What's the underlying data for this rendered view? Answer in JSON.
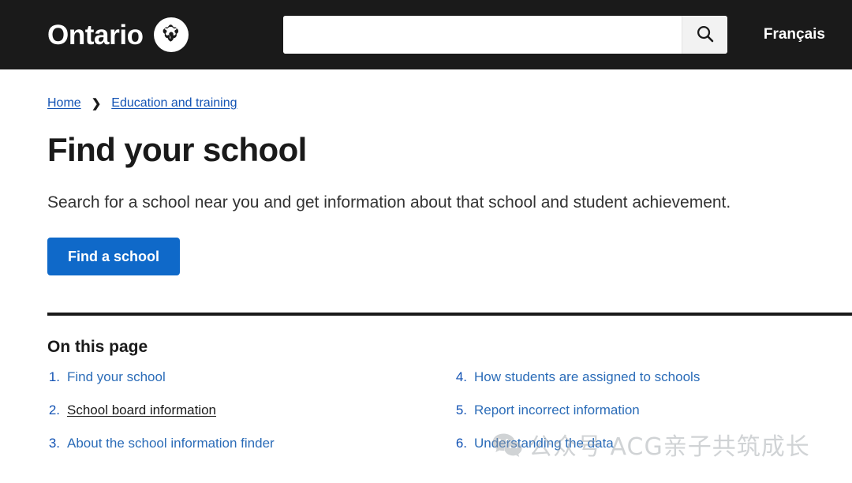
{
  "header": {
    "brand_name": "Ontario",
    "logo_icon": "ontario-trillium-icon",
    "language_toggle": "Français",
    "search": {
      "value": "",
      "placeholder": "",
      "button_icon": "search-icon",
      "button_label": "Search"
    }
  },
  "breadcrumb": {
    "items": [
      {
        "label": "Home"
      },
      {
        "label": "Education and training"
      }
    ],
    "separator": "❯"
  },
  "main": {
    "title": "Find your school",
    "lede": "Search for a school near you and get information about that school and student achievement.",
    "cta_label": "Find a school"
  },
  "on_this_page": {
    "heading": "On this page",
    "left_items": [
      {
        "number": "1.",
        "label": "Find your school",
        "hovered": false
      },
      {
        "number": "2.",
        "label": "School board information",
        "hovered": true
      },
      {
        "number": "3.",
        "label": "About the school information finder",
        "hovered": false
      }
    ],
    "right_items": [
      {
        "number": "4.",
        "label": "How students are assigned to schools",
        "hovered": false
      },
      {
        "number": "5.",
        "label": "Report incorrect information",
        "hovered": false
      },
      {
        "number": "6.",
        "label": "Understanding the data",
        "hovered": false
      }
    ]
  },
  "watermark": {
    "icon": "wechat-icon",
    "text": "公众号 ACG亲子共筑成长"
  },
  "colors": {
    "header_bg": "#1a1a1a",
    "link_blue": "#1353b4",
    "list_link_blue": "#2b6cb8",
    "cta_blue": "#0f69c9",
    "text_dark": "#1a1a1a",
    "watermark_gray": "#9aa0a6"
  }
}
